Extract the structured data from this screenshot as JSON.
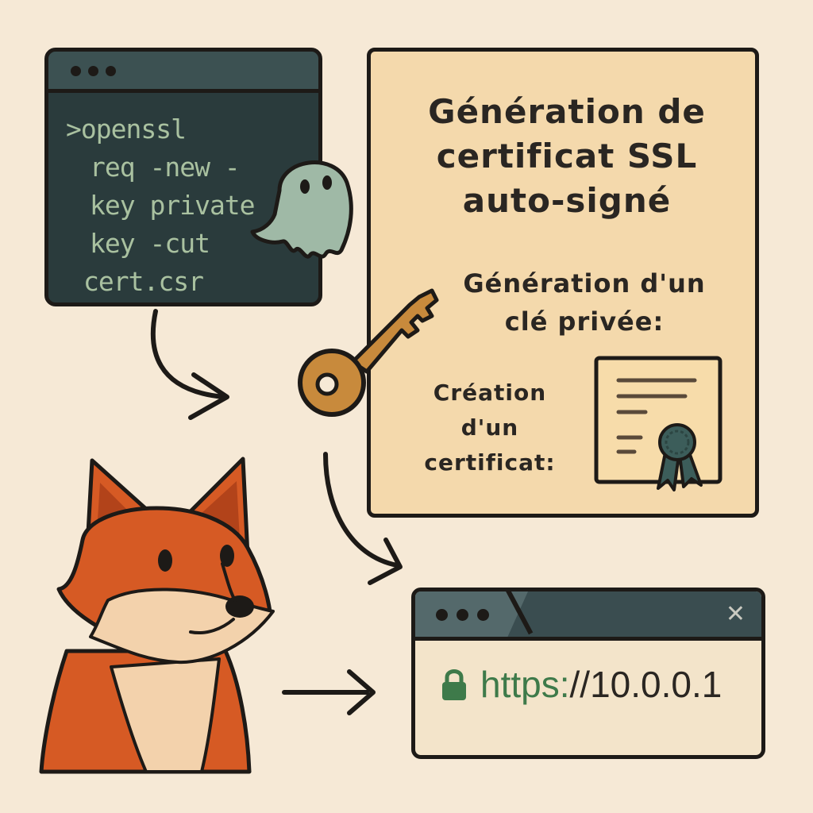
{
  "terminal": {
    "lines": [
      ">openssl",
      "req -new -",
      "key private",
      "key -cut",
      "cert.csr"
    ]
  },
  "info": {
    "title_lines": [
      "Génération de",
      "certificat SSL",
      "auto-signé"
    ],
    "step1_lines": [
      "Génération d'un",
      "clé privée:"
    ],
    "step2_lines": [
      "Création",
      "d'un",
      "certificat:"
    ]
  },
  "browser": {
    "close_glyph": "✕",
    "url_scheme": "https:",
    "url_rest": "//10.0.0.1"
  },
  "colors": {
    "background": "#f6e9d6",
    "terminal_bg": "#2a3b3c",
    "terminal_text": "#a9c1a0",
    "panel_bg": "#f4d9ac",
    "fox": "#d65a24",
    "key": "#c88a3c",
    "ribbon": "#3c5d5a",
    "lock": "#3e7a4a"
  }
}
